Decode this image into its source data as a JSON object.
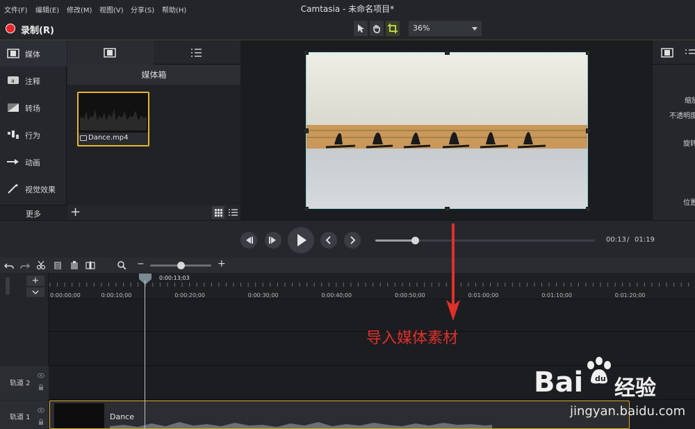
{
  "window": {
    "title": "Camtasia - 未命名项目*"
  },
  "menu": [
    "文件(F)",
    "编辑(E)",
    "修改(M)",
    "视图(V)",
    "分享(S)",
    "帮助(H)"
  ],
  "toolbar": {
    "record_label": "录制(R)",
    "zoom": "36%"
  },
  "sidebar": {
    "items": [
      {
        "label": "媒体",
        "icon": "film-icon"
      },
      {
        "label": "注释",
        "icon": "annotation-icon"
      },
      {
        "label": "转场",
        "icon": "transition-icon"
      },
      {
        "label": "行为",
        "icon": "behavior-icon"
      },
      {
        "label": "动画",
        "icon": "animation-icon"
      },
      {
        "label": "视觉效果",
        "icon": "magic-wand-icon"
      }
    ],
    "more": "更多"
  },
  "media_bin": {
    "title": "媒体箱",
    "clip_name": "Dance.mp4",
    "add": "+"
  },
  "properties": {
    "labels": [
      "缩放",
      "不透明度",
      "旋转",
      "位置"
    ]
  },
  "playback": {
    "current": "00:13",
    "separator": "/",
    "total": "01:19",
    "progress": 0.18
  },
  "timeline": {
    "playhead_time": "0:00:13;03",
    "zoom_minus": "−",
    "zoom_plus": "+",
    "zoom_level": 0.5,
    "ruler": [
      "0:00:00;00",
      "0:00:10;00",
      "0:00:20;00",
      "0:00:30;00",
      "0:00:40;00",
      "0:00:50;00",
      "0:01:00;00",
      "0:01:10;00",
      "0:01:20;00"
    ],
    "tracks": [
      {
        "name": "轨道 2"
      },
      {
        "name": "轨道 1",
        "clip": "Dance"
      }
    ]
  },
  "annotation": "导入媒体素材",
  "watermark": {
    "brand": "Bai",
    "brand2": "经验",
    "url": "jingyan.baidu.com"
  },
  "colors": {
    "accent": "#e8b62e",
    "record": "#e8262c",
    "annotation": "#e0302b",
    "preview_border": "#8fd3d9"
  }
}
